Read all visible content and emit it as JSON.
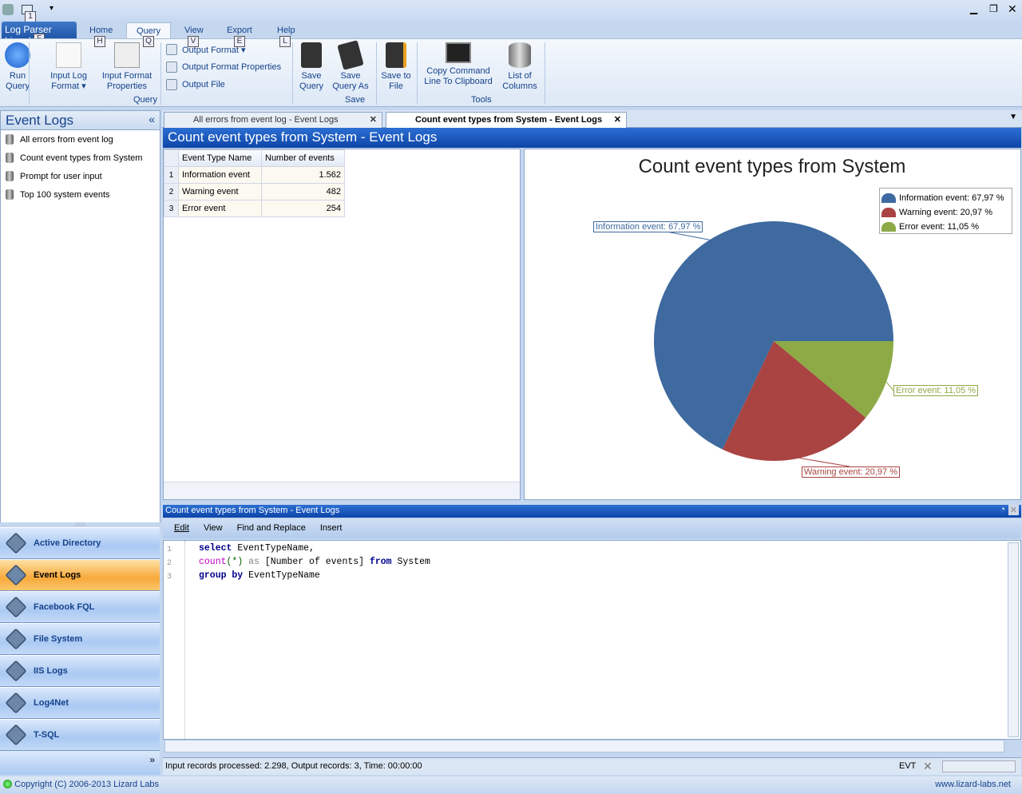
{
  "quick_access": {
    "keytip": "1"
  },
  "ribbon": {
    "app_button": "Log Parser Lizard",
    "app_keytip": "F",
    "tabs": [
      {
        "label": "Home",
        "keytip": "H"
      },
      {
        "label": "Query",
        "keytip": "Q"
      },
      {
        "label": "View",
        "keytip": "V"
      },
      {
        "label": "Export",
        "keytip": "E"
      },
      {
        "label": "Help",
        "keytip": "L"
      }
    ],
    "run_query": "Run Query",
    "input_log_format": "Input Log Format ▾",
    "input_format_properties": "Input Format Properties",
    "output_format": "Output Format ▾",
    "output_format_properties": "Output Format Properties",
    "output_file": "Output File",
    "group_query": "Query",
    "save_query": "Save Query",
    "save_query_as": "Save Query As",
    "save_to_file": "Save to File",
    "group_save": "Save",
    "copy_command": "Copy Command Line To Clipboard",
    "list_columns": "List of Columns",
    "group_tools": "Tools"
  },
  "sidebar": {
    "title": "Event Logs",
    "items": [
      "All errors from event log",
      "Count event types from System",
      "Prompt for user input",
      "Top 100 system events"
    ],
    "nav": [
      "Active Directory",
      "Event Logs",
      "Facebook FQL",
      "File System",
      "IIS Logs",
      "Log4Net",
      "T-SQL"
    ],
    "active_nav": "Event Logs"
  },
  "doc_tabs": [
    {
      "label": "All errors from event log - Event Logs"
    },
    {
      "label": "Count event types from System - Event Logs",
      "active": true
    }
  ],
  "doc_title": "Count event types from System - Event Logs",
  "grid": {
    "columns": [
      "Event Type Name",
      "Number of events"
    ],
    "rows": [
      [
        "1",
        "Information event",
        "1.562"
      ],
      [
        "2",
        "Warning event",
        "482"
      ],
      [
        "3",
        "Error event",
        "254"
      ]
    ]
  },
  "chart_data": {
    "type": "pie",
    "title": "Count event types from System",
    "legend": "top-right",
    "categories": [
      "Information event",
      "Warning event",
      "Error event"
    ],
    "values": [
      1562,
      482,
      254
    ],
    "percent": [
      67.97,
      20.97,
      11.05
    ],
    "labels": [
      "Information event: 67,97 %",
      "Warning event: 20,97 %",
      "Error event: 11,05 %"
    ],
    "colors": [
      "#3e6aa0",
      "#a94442",
      "#8daa47"
    ]
  },
  "editor": {
    "title": "Count event types from System - Event Logs",
    "menu": [
      "Edit",
      "View",
      "Find and Replace",
      "Insert"
    ],
    "lines": [
      {
        "n": "1"
      },
      {
        "n": "2"
      },
      {
        "n": "3"
      }
    ],
    "code": {
      "l1a": "select",
      "l1b": " EventTypeName,",
      "l2a": "count",
      "l2b": "(*)",
      "l2c": " as ",
      "l2d": "[Number of events]",
      "l2e": " from",
      "l2f": " System",
      "l3a": "group by",
      "l3b": " EventTypeName"
    }
  },
  "status": {
    "text": "Input records processed: 2.298, Output records: 3, Time: 00:00:00",
    "evt": "EVT"
  },
  "footer": {
    "copyright": "Copyright (C) 2006-2013 Lizard Labs",
    "url": "www.lizard-labs.net"
  }
}
